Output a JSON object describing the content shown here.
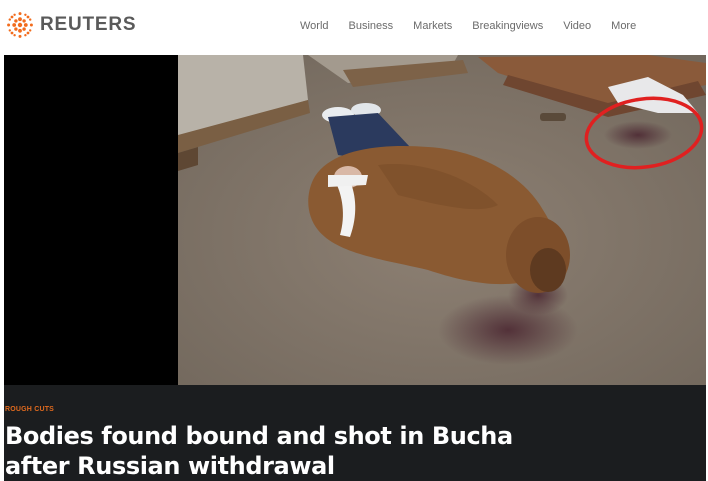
{
  "header": {
    "brand": "REUTERS",
    "brand_color": "#f26c1d",
    "logo_icon": "reuters-dot-logo",
    "nav": [
      "World",
      "Business",
      "Markets",
      "Breakingviews",
      "Video",
      "More"
    ]
  },
  "video": {
    "scene": "still-frame",
    "highlight_color": "#e02020"
  },
  "article": {
    "kicker": "ROUGH CUTS",
    "kicker_color": "#e06a1f",
    "headline": "Bodies found bound and shot in Bucha after Russian withdrawal"
  }
}
